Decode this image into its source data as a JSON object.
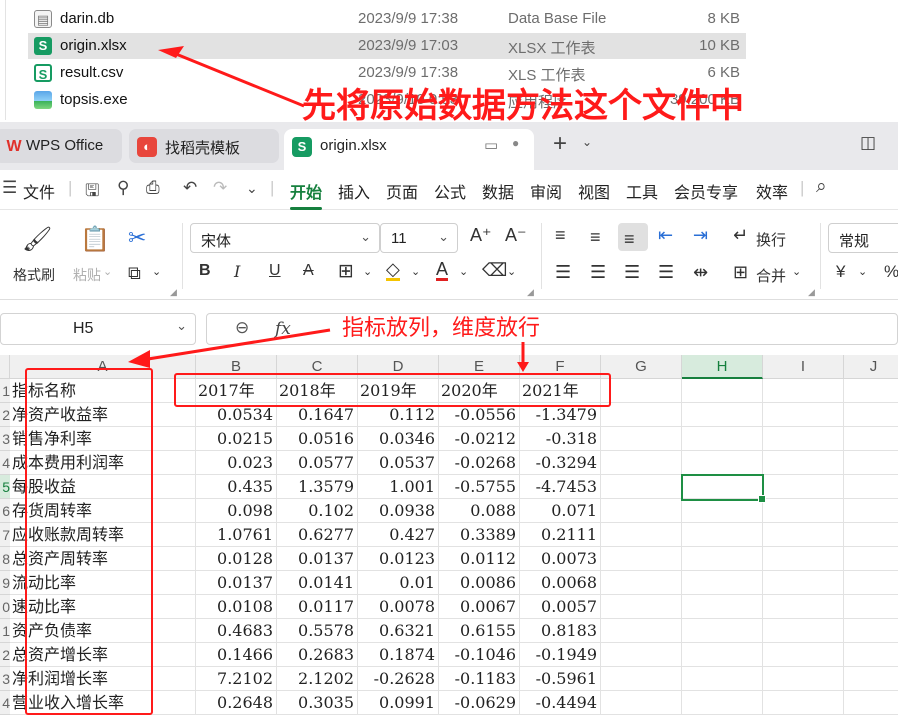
{
  "explorer": {
    "files": [
      {
        "name": "darin.db",
        "date": "2023/9/9 17:38",
        "type": "Data Base File",
        "size": "8 KB",
        "icon": "db-file-icon"
      },
      {
        "name": "origin.xlsx",
        "date": "2023/9/9 17:03",
        "type": "XLSX 工作表",
        "size": "10 KB",
        "icon": "wps-spreadsheet-icon",
        "selected": true
      },
      {
        "name": "result.csv",
        "date": "2023/9/9 17:38",
        "type": "XLS 工作表",
        "size": "6 KB",
        "icon": "wps-spreadsheet-outline-icon"
      },
      {
        "name": "topsis.exe",
        "date": "2023/9/10 0:53",
        "type": "应用程序",
        "size": "39,200 KB",
        "icon": "exe-file-icon"
      }
    ]
  },
  "tabs": [
    {
      "label": "WPS Office",
      "icon": "wps-logo-icon"
    },
    {
      "label": "找稻壳模板",
      "icon": "docer-icon"
    },
    {
      "label": "origin.xlsx",
      "icon": "spreadsheet-icon",
      "active": true
    }
  ],
  "menu": {
    "file": "文件",
    "items": [
      "开始",
      "插入",
      "页面",
      "公式",
      "数据",
      "审阅",
      "视图",
      "工具",
      "会员专享",
      "效率"
    ],
    "active": "开始"
  },
  "ribbon": {
    "format_painter": "格式刷",
    "paste": "粘贴",
    "font_name": "宋体",
    "font_size": "11",
    "wrap": "换行",
    "merge": "合并",
    "number_format": "常规"
  },
  "formula_bar": {
    "name_box": "H5",
    "fx_label": "fx",
    "content": ""
  },
  "sheet": {
    "columns": [
      "A",
      "B",
      "C",
      "D",
      "E",
      "F",
      "G",
      "H",
      "I",
      "J"
    ],
    "selected_column": "H",
    "selected_row": 5,
    "row_numbers": [
      "1",
      "2",
      "3",
      "4",
      "5",
      "6",
      "7",
      "8",
      "9",
      "0",
      "1",
      "2",
      "3",
      "4"
    ],
    "header_row": [
      "指标名称",
      "2017年",
      "2018年",
      "2019年",
      "2020年",
      "2021年"
    ],
    "rows": [
      [
        "净资产收益率",
        "0.0534",
        "0.1647",
        "0.112",
        "-0.0556",
        "-1.3479"
      ],
      [
        "销售净利率",
        "0.0215",
        "0.0516",
        "0.0346",
        "-0.0212",
        "-0.318"
      ],
      [
        "成本费用利润率",
        "0.023",
        "0.0577",
        "0.0537",
        "-0.0268",
        "-0.3294"
      ],
      [
        "每股收益",
        "0.435",
        "1.3579",
        "1.001",
        "-0.5755",
        "-4.7453"
      ],
      [
        "存货周转率",
        "0.098",
        "0.102",
        "0.0938",
        "0.088",
        "0.071"
      ],
      [
        "应收账款周转率",
        "1.0761",
        "0.6277",
        "0.427",
        "0.3389",
        "0.2111"
      ],
      [
        "总资产周转率",
        "0.0128",
        "0.0137",
        "0.0123",
        "0.0112",
        "0.0073"
      ],
      [
        "流动比率",
        "0.0137",
        "0.0141",
        "0.01",
        "0.0086",
        "0.0068"
      ],
      [
        "速动比率",
        "0.0108",
        "0.0117",
        "0.0078",
        "0.0067",
        "0.0057"
      ],
      [
        "资产负债率",
        "0.4683",
        "0.5578",
        "0.6321",
        "0.6155",
        "0.8183"
      ],
      [
        "总资产增长率",
        "0.1466",
        "0.2683",
        "0.1874",
        "-0.1046",
        "-0.1949"
      ],
      [
        "净利润增长率",
        "7.2102",
        "2.1202",
        "-0.2628",
        "-0.1183",
        "-0.5961"
      ],
      [
        "营业收入增长率",
        "0.2648",
        "0.3035",
        "0.0991",
        "-0.0629",
        "-0.4494"
      ]
    ]
  },
  "annotations": {
    "file_note": "先将原始数据方法这个文件中",
    "layout_note": "指标放列，维度放行"
  },
  "colors": {
    "accent": "#16803e",
    "annotation": "#ff1a1a",
    "selection": "#1e8f44"
  }
}
